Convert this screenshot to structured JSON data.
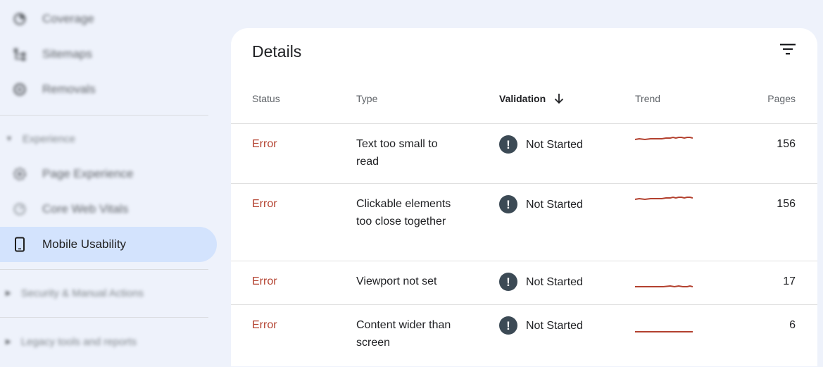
{
  "sidebar": {
    "items_top": [
      {
        "label": "Coverage",
        "icon": "coverage-icon"
      },
      {
        "label": "Sitemaps",
        "icon": "sitemaps-icon"
      },
      {
        "label": "Removals",
        "icon": "removals-icon"
      }
    ],
    "experience_section": {
      "label": "Experience",
      "items": [
        {
          "label": "Page Experience",
          "icon": "page-experience-icon"
        },
        {
          "label": "Core Web Vitals",
          "icon": "core-web-vitals-icon"
        },
        {
          "label": "Mobile Usability",
          "icon": "smartphone-icon",
          "active": true
        }
      ]
    },
    "security_section": {
      "label": "Security & Manual Actions"
    },
    "legacy_section": {
      "label": "Legacy tools and reports"
    }
  },
  "details": {
    "title": "Details",
    "columns": {
      "status": "Status",
      "type": "Type",
      "validation": "Validation",
      "trend": "Trend",
      "pages": "Pages"
    },
    "sort_column": "validation",
    "sort_direction": "descending",
    "rows": [
      {
        "status": "Error",
        "type": "Text too small to read",
        "validation": "Not Started",
        "pages": "156"
      },
      {
        "status": "Error",
        "type": "Clickable elements too close together",
        "validation": "Not Started",
        "pages": "156"
      },
      {
        "status": "Error",
        "type": "Viewport not set",
        "validation": "Not Started",
        "pages": "17"
      },
      {
        "status": "Error",
        "type": "Content wider than screen",
        "validation": "Not Started",
        "pages": "6"
      }
    ]
  },
  "colors": {
    "error": "#b3412f",
    "trend_line": "#b3412f",
    "active_nav": "#d3e3fd",
    "background": "#eef2fb",
    "validation_badge": "#3c4a55"
  }
}
